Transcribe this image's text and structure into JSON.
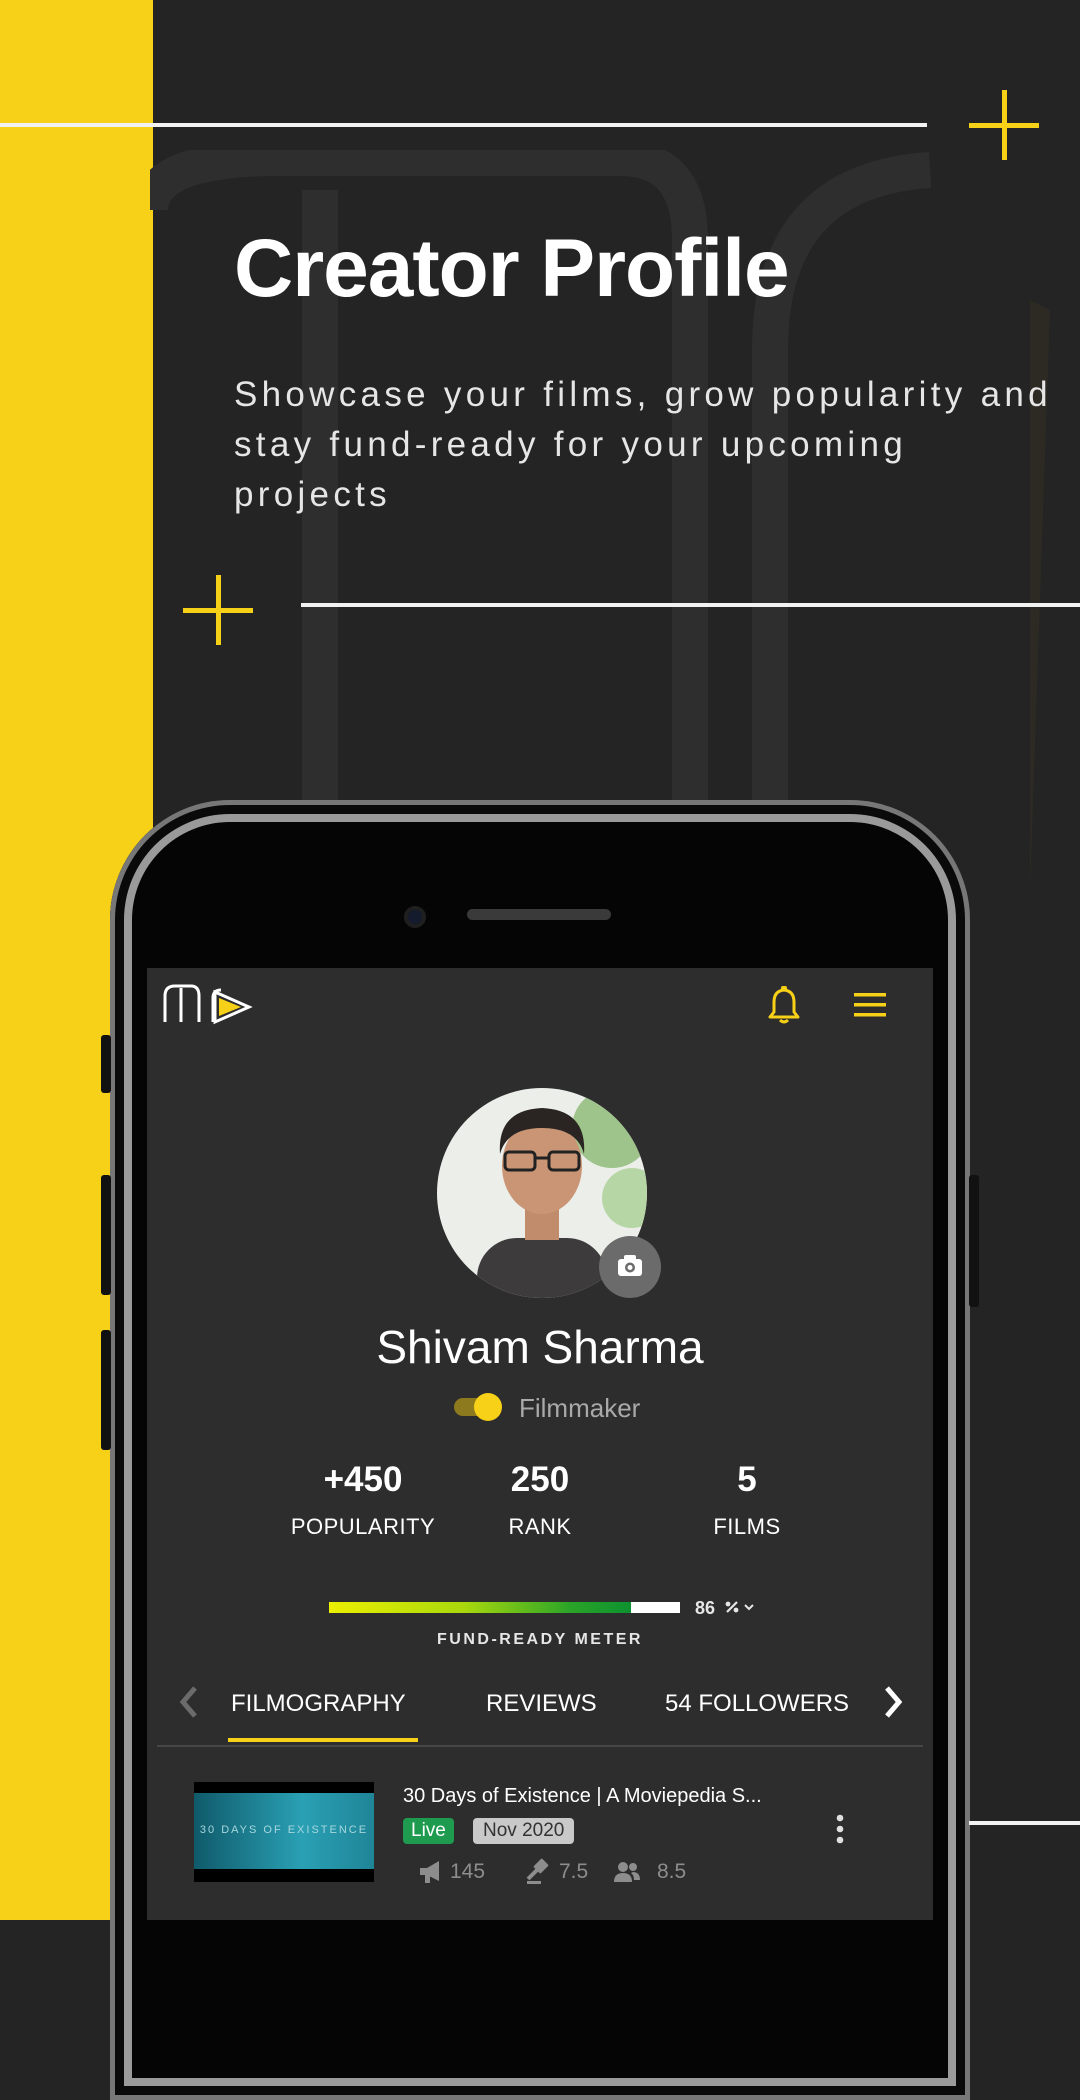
{
  "colors": {
    "accent": "#F7D117",
    "background": "#242424",
    "screen": "#2d2d2d",
    "live": "#1e9b4f"
  },
  "promo": {
    "headline": "Creator Profile",
    "subtitle": "Showcase your films, grow popularity and stay fund-ready for your upcoming projects"
  },
  "app": {
    "logo_icon": "moviepedia-logo",
    "notification_icon": "bell-icon",
    "menu_icon": "hamburger-icon"
  },
  "profile": {
    "name": "Shivam Sharma",
    "role": "Filmmaker",
    "role_toggle_on": true,
    "camera_icon": "camera-icon"
  },
  "stats": [
    {
      "value": "+450",
      "label": "POPULARITY"
    },
    {
      "value": "250",
      "label": "RANK"
    },
    {
      "value": "5",
      "label": "FILMS"
    }
  ],
  "fund_meter": {
    "percent": 86,
    "percent_text": "86",
    "label": "FUND-READY METER"
  },
  "tabs": [
    {
      "label": "FILMOGRAPHY",
      "active": true
    },
    {
      "label": "REVIEWS",
      "active": false
    },
    {
      "label": "54 FOLLOWERS",
      "active": false
    }
  ],
  "films": [
    {
      "title": "30 Days of Existence | A Moviepedia S...",
      "thumbnail_text": "30 DAYS OF EXISTENCE",
      "status": "Live",
      "date": "Nov 2020",
      "promotions": "145",
      "rating": "7.5",
      "audience": "8.5"
    }
  ]
}
